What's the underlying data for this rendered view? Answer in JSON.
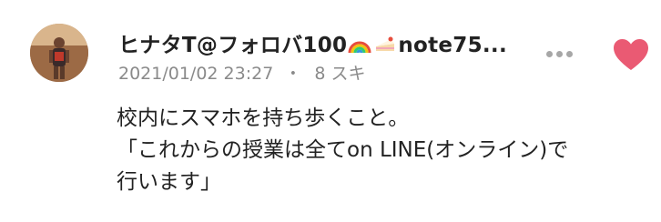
{
  "post": {
    "author": {
      "name_prefix": "ヒナタT@フォロバ100",
      "name_suffix": "note75...",
      "name_emojis": [
        "rainbow-emoji",
        "cake-emoji"
      ]
    },
    "timestamp": "2021/01/02 23:27",
    "separator": "・",
    "likes_label": "8 スキ",
    "body_lines": [
      "校内にスマホを持ち歩くこと。",
      "「これからの授業は全てon LINE(オンライン)で",
      "行います」"
    ]
  },
  "colors": {
    "like": "#ea5a73",
    "meta_text": "#8a8a8a",
    "menu_dots": "#a7a7a7",
    "text": "#222222"
  },
  "icons": {
    "menu": "more-dots-icon",
    "like": "heart-icon"
  }
}
